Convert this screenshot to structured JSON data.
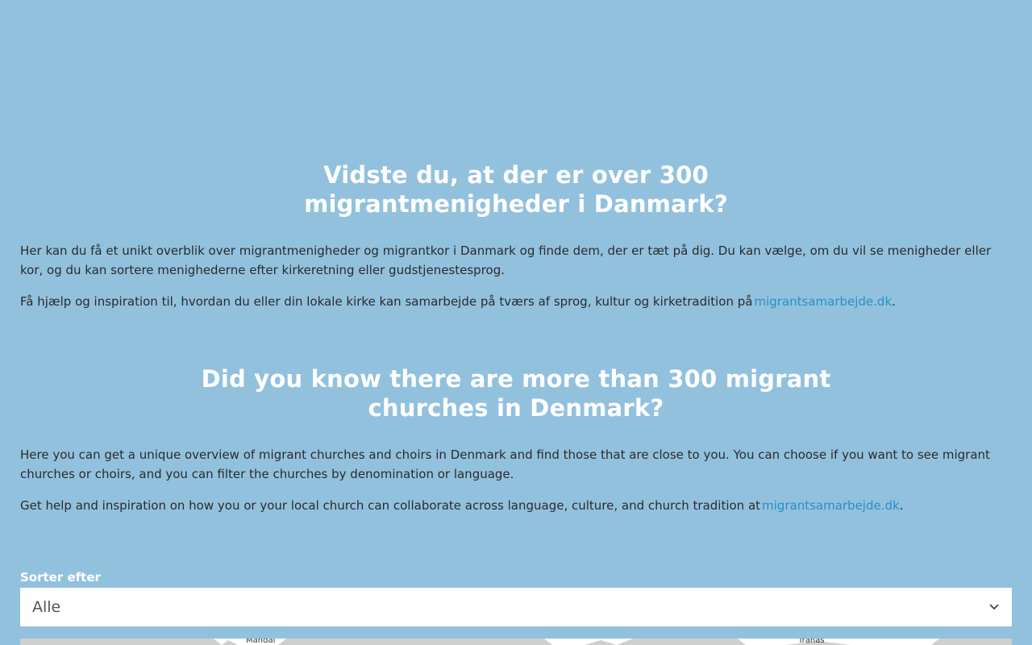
{
  "danish": {
    "heading": "Vidste du, at der er over 300 migrantmenigheder i Danmark?",
    "paragraph1": "Her kan du få et unikt overblik over migrantmenigheder og migrantkor i Danmark og finde dem, der er tæt på dig. Du kan vælge, om du vil se menigheder eller kor, og du kan sortere menighederne efter kirkeretning eller gudstjenestesprog.",
    "paragraph2_text": "Få hjælp og inspiration til, hvordan du eller din lokale kirke kan samarbejde på tværs af sprog, kultur og kirketradition på",
    "paragraph2_link": "migrantsamarbejde.dk",
    "paragraph2_end": "."
  },
  "english": {
    "heading": "Did you know there are more than 300 migrant churches in Denmark?",
    "paragraph1": "Here you can get a unique overview of migrant churches and choirs in Denmark and find those that are close to you. You can choose if you want to see migrant churches or choirs, and you can filter the churches by denomination or language.",
    "paragraph2_text": "Get help and inspiration on how you or your local church can collaborate across language, culture, and church tradition at",
    "paragraph2_link": "migrantsamarbejde.dk",
    "paragraph2_end": "."
  },
  "filter": {
    "label": "Sorter efter",
    "selected": "Alle",
    "chevron_icon": "chevron-down-icon"
  },
  "map": {
    "labels": [
      "Mandal",
      "Tranås"
    ]
  },
  "colors": {
    "background": "#92c1de",
    "link": "#2a8fc4",
    "heading": "#ffffff"
  }
}
